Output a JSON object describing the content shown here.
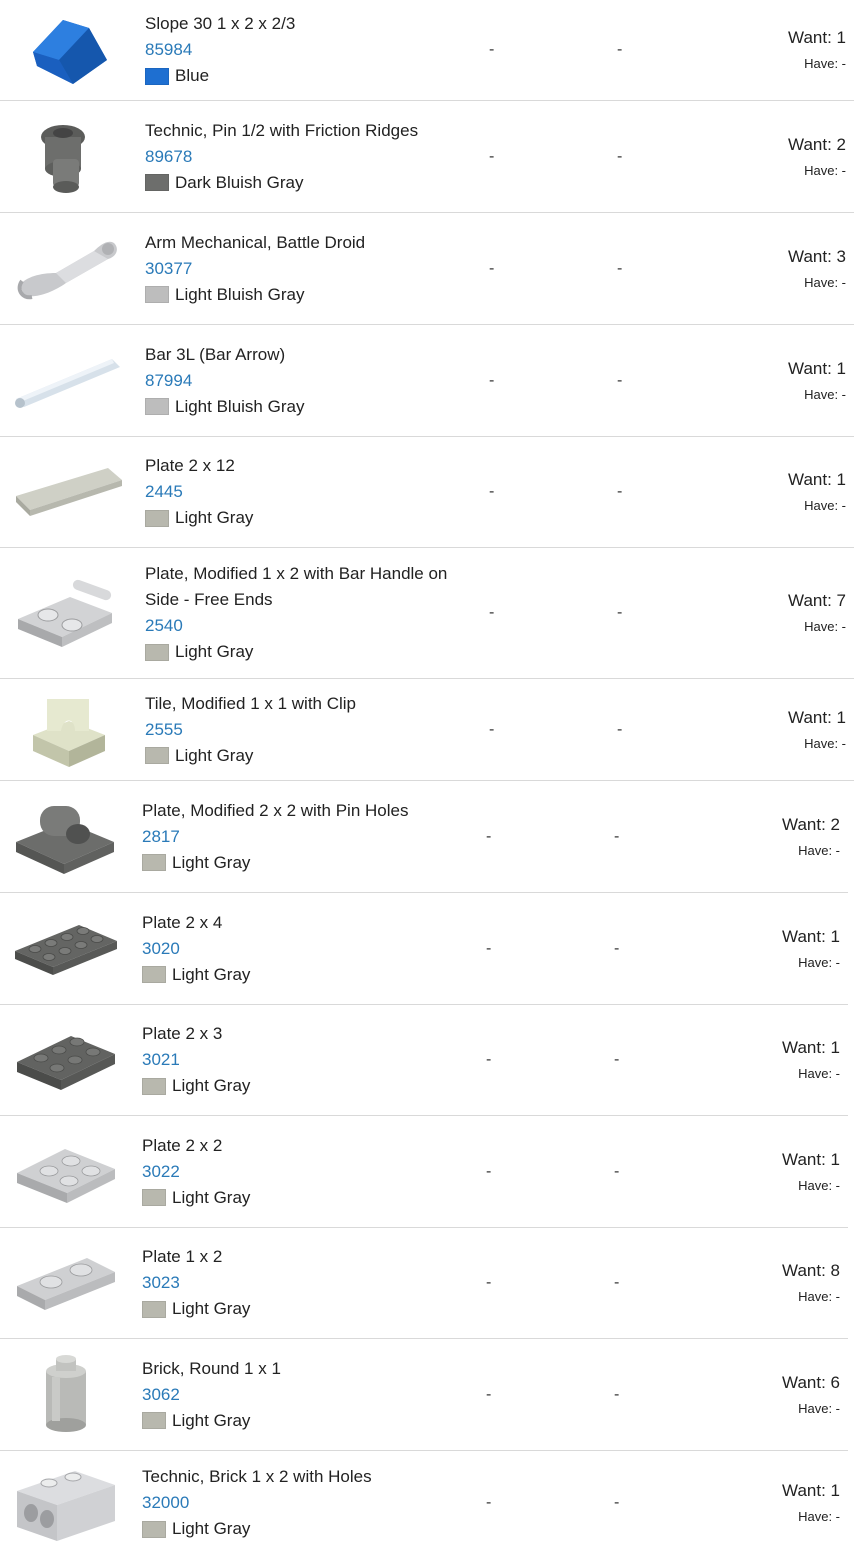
{
  "items": [
    {
      "name": "Slope 30 1 x 2 x 2/3",
      "part_no": "85984",
      "color_name": "Blue",
      "color_hex": "#1e6fd1",
      "col1": "-",
      "col2": "-",
      "want": "Want: 1",
      "have": "Have: -",
      "icon": "slope-blue-icon"
    },
    {
      "name": "Technic, Pin 1/2 with Friction Ridges",
      "part_no": "89678",
      "color_name": "Dark Bluish Gray",
      "color_hex": "#6d6e6c",
      "col1": "-",
      "col2": "-",
      "want": "Want: 2",
      "have": "Have: -",
      "icon": "technic-pin-icon"
    },
    {
      "name": "Arm Mechanical, Battle Droid",
      "part_no": "30377",
      "color_name": "Light Bluish Gray",
      "color_hex": "#bdbdbd",
      "col1": "-",
      "col2": "-",
      "want": "Want: 3",
      "have": "Have: -",
      "icon": "droid-arm-icon"
    },
    {
      "name": "Bar 3L (Bar Arrow)",
      "part_no": "87994",
      "color_name": "Light Bluish Gray",
      "color_hex": "#bdbdbd",
      "col1": "-",
      "col2": "-",
      "want": "Want: 1",
      "have": "Have: -",
      "icon": "bar-icon"
    },
    {
      "name": "Plate 2 x 12",
      "part_no": "2445",
      "color_name": "Light Gray",
      "color_hex": "#b8b8ae",
      "col1": "-",
      "col2": "-",
      "want": "Want: 1",
      "have": "Have: -",
      "icon": "plate-2x12-icon"
    },
    {
      "name": "Plate, Modified 1 x 2 with Bar Handle on Side - Free Ends",
      "part_no": "2540",
      "color_name": "Light Gray",
      "color_hex": "#b8b8ae",
      "col1": "-",
      "col2": "-",
      "want": "Want: 7",
      "have": "Have: -",
      "icon": "plate-handle-icon"
    },
    {
      "name": "Tile, Modified 1 x 1 with Clip",
      "part_no": "2555",
      "color_name": "Light Gray",
      "color_hex": "#b8b8ae",
      "col1": "-",
      "col2": "-",
      "want": "Want: 1",
      "have": "Have: -",
      "icon": "tile-clip-icon"
    },
    {
      "name": "Plate, Modified 2 x 2 with Pin Holes",
      "part_no": "2817",
      "color_name": "Light Gray",
      "color_hex": "#b8b8ae",
      "col1": "-",
      "col2": "-",
      "want": "Want: 2",
      "have": "Have: -",
      "icon": "plate-pinhole-icon"
    },
    {
      "name": "Plate 2 x 4",
      "part_no": "3020",
      "color_name": "Light Gray",
      "color_hex": "#b8b8ae",
      "col1": "-",
      "col2": "-",
      "want": "Want: 1",
      "have": "Have: -",
      "icon": "plate-2x4-icon"
    },
    {
      "name": "Plate 2 x 3",
      "part_no": "3021",
      "color_name": "Light Gray",
      "color_hex": "#b8b8ae",
      "col1": "-",
      "col2": "-",
      "want": "Want: 1",
      "have": "Have: -",
      "icon": "plate-2x3-icon"
    },
    {
      "name": "Plate 2 x 2",
      "part_no": "3022",
      "color_name": "Light Gray",
      "color_hex": "#b8b8ae",
      "col1": "-",
      "col2": "-",
      "want": "Want: 1",
      "have": "Have: -",
      "icon": "plate-2x2-icon"
    },
    {
      "name": "Plate 1 x 2",
      "part_no": "3023",
      "color_name": "Light Gray",
      "color_hex": "#b8b8ae",
      "col1": "-",
      "col2": "-",
      "want": "Want: 8",
      "have": "Have: -",
      "icon": "plate-1x2-icon"
    },
    {
      "name": "Brick, Round 1 x 1",
      "part_no": "3062",
      "color_name": "Light Gray",
      "color_hex": "#b8b8ae",
      "col1": "-",
      "col2": "-",
      "want": "Want: 6",
      "have": "Have: -",
      "icon": "round-brick-icon"
    },
    {
      "name": "Technic, Brick 1 x 2 with Holes",
      "part_no": "32000",
      "color_name": "Light Gray",
      "color_hex": "#b8b8ae",
      "col1": "-",
      "col2": "-",
      "want": "Want: 1",
      "have": "Have: -",
      "icon": "technic-brick-icon"
    }
  ]
}
